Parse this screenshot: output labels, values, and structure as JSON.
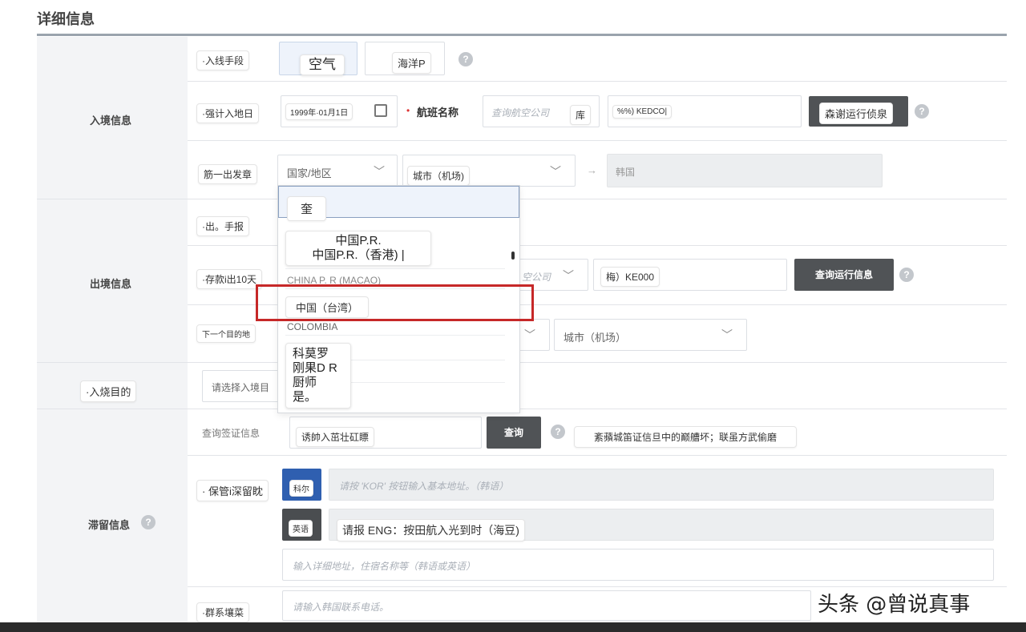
{
  "title": "详细信息",
  "sections": {
    "entry": "入境信息",
    "exit": "出境信息",
    "purpose": "·入烧目的",
    "stay": "滞留信息"
  },
  "rows": {
    "entry_method": {
      "label": "·入线手段",
      "options": [
        "空气",
        "海洋P"
      ]
    },
    "entry_date": {
      "label": "·强计入地日",
      "date_value": "1999年·01月1日",
      "flight_label": "航班名称",
      "airline_placeholder": "查询航空公司",
      "airline_tag": "库",
      "flight_value": "%%) KEDCO|",
      "button": "森谢运行侦泉"
    },
    "departure": {
      "label": "筋一出发章",
      "country_placeholder": "国家/地区",
      "city_tag": "城市（机场)",
      "arrow": "→",
      "destination_value": "韩国"
    },
    "exit_method": {
      "label": "·出。手报"
    },
    "exit_date": {
      "label": "·存款i出10天",
      "airline_partial": "空公司",
      "flight_value": "梅）KE000",
      "button": "查询运行信息"
    },
    "next_destination": {
      "label": "下一个目的地",
      "city_placeholder": "城市（机场）"
    },
    "purpose": {
      "placeholder": "请选择入境目"
    },
    "visa": {
      "label": "查询签证信息",
      "input_tag": "诱帥入茁壮矼瞟",
      "button": "查询",
      "hint": "紊蘋城笛证信旦中的巅艚坏；联虽方武偷磨"
    },
    "stay_address": {
      "label": "· 保管i深留眈",
      "kor_tag": "科尔",
      "kor_placeholder": "请按 'KOR' 按钮输入基本地址。（韩语）",
      "eng_tag": "英语",
      "eng_hint": "请报 ENG：按田航入光到时（海豆)",
      "detail_placeholder": "输入详细地址，住宿名称等（韩语或英语）"
    },
    "contact": {
      "label": "·群系壤菜",
      "placeholder": "请输入韩国联系电话。"
    }
  },
  "dropdown": {
    "search_tag": "奎",
    "callout_lines": [
      "中国P.R.",
      "中国P.R.（香港) |"
    ],
    "item_macao": "CHINA P. R (MACAO)",
    "item_taiwan": "中国（台湾）",
    "item_colombia": "COLOMBIA",
    "callout2_lines": [
      "科莫罗",
      "刚果D R",
      "厨师",
      "是。"
    ]
  },
  "colors": {
    "highlight_border": "#c62828",
    "dark_button": "#505356",
    "left_column": "#f3f4f6"
  },
  "watermark": "头条 @曾说真事"
}
